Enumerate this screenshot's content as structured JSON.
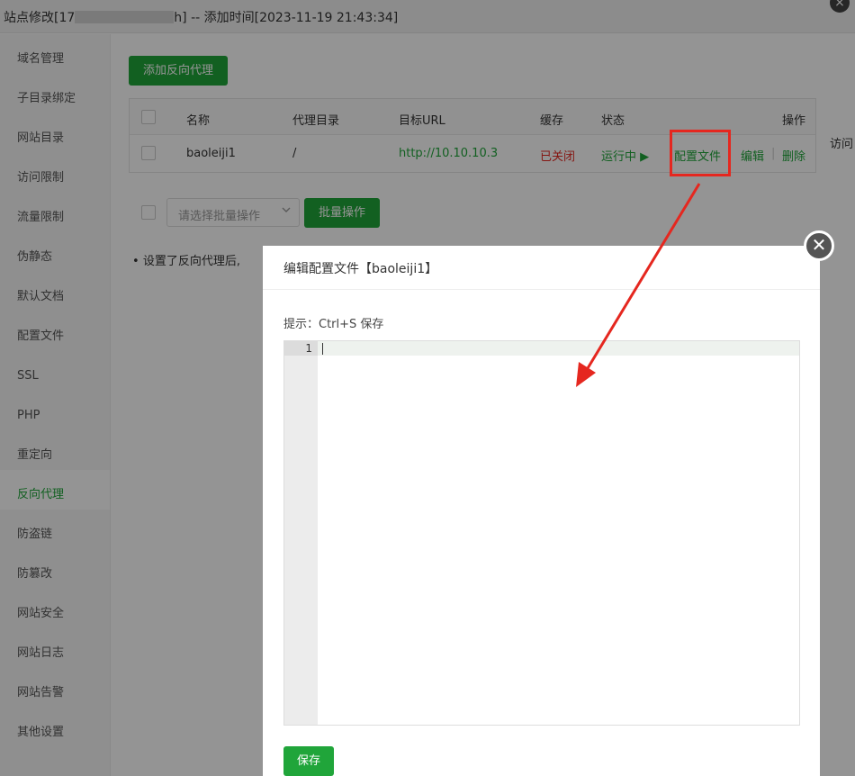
{
  "window": {
    "title_prefix": "站点修改[17",
    "title_suffix": "h] -- 添加时间[2023-11-19 21:43:34]",
    "close_glyph": "×"
  },
  "sidebar": {
    "items": [
      {
        "label": "域名管理"
      },
      {
        "label": "子目录绑定"
      },
      {
        "label": "网站目录"
      },
      {
        "label": "访问限制"
      },
      {
        "label": "流量限制"
      },
      {
        "label": "伪静态"
      },
      {
        "label": "默认文档"
      },
      {
        "label": "配置文件"
      },
      {
        "label": "SSL"
      },
      {
        "label": "PHP"
      },
      {
        "label": "重定向"
      },
      {
        "label": "反向代理"
      },
      {
        "label": "防盗链"
      },
      {
        "label": "防篡改"
      },
      {
        "label": "网站安全"
      },
      {
        "label": "网站日志"
      },
      {
        "label": "网站告警"
      },
      {
        "label": "其他设置"
      }
    ],
    "active_index": 11
  },
  "proxy": {
    "add_button": "添加反向代理",
    "columns": {
      "name": "名称",
      "dir": "代理目录",
      "url": "目标URL",
      "cache": "缓存",
      "status": "状态",
      "ops": "操作"
    },
    "row": {
      "name": "baoleiji1",
      "dir": "/",
      "url": "http://10.10.10.3",
      "cache": "已关闭",
      "status": "运行中 ▶",
      "config": "配置文件",
      "edit": "编辑",
      "sep": "|",
      "delete": "删除"
    },
    "batch_placeholder": "请选择批量操作",
    "batch_button": "批量操作",
    "note": "设置了反向代理后,",
    "edge_text": "访问"
  },
  "modal": {
    "title": "编辑配置文件【baoleiji1】",
    "hint": "提示：Ctrl+S 保存",
    "line_number": "1",
    "save_button": "保存",
    "close_glyph": "✕"
  },
  "colors": {
    "accent": "#20a53a",
    "danger": "#e5271f"
  }
}
